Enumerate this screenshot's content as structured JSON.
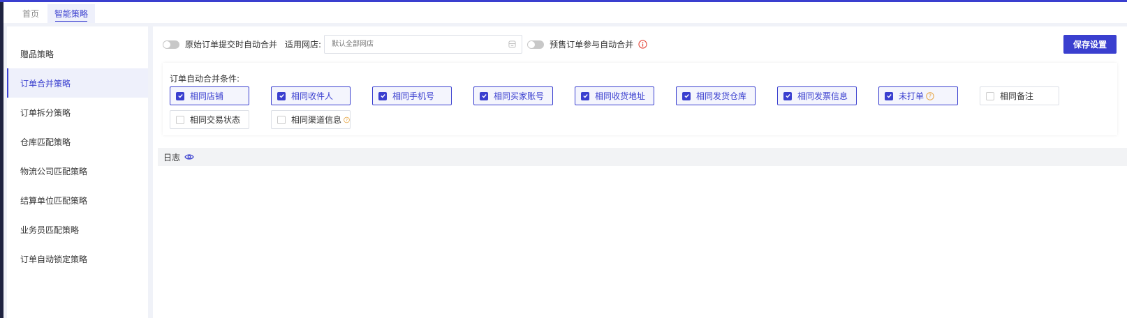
{
  "tabs": [
    {
      "label": "首页",
      "active": false
    },
    {
      "label": "智能策略",
      "active": true
    }
  ],
  "sidebar": {
    "items": [
      {
        "label": "赠品策略",
        "active": false
      },
      {
        "label": "订单合并策略",
        "active": true
      },
      {
        "label": "订单拆分策略",
        "active": false
      },
      {
        "label": "仓库匹配策略",
        "active": false
      },
      {
        "label": "物流公司匹配策略",
        "active": false
      },
      {
        "label": "结算单位匹配策略",
        "active": false
      },
      {
        "label": "业务员匹配策略",
        "active": false
      },
      {
        "label": "订单自动锁定策略",
        "active": false
      }
    ]
  },
  "toolbar": {
    "auto_merge_label": "原始订单提交时自动合并",
    "auto_merge_on": false,
    "shop_label": "适用网店:",
    "shop_placeholder": "默认全部网店",
    "presale_label": "预售订单参与自动合并",
    "presale_on": false,
    "save_label": "保存设置"
  },
  "conditions": {
    "title": "订单自动合并条件:",
    "items": [
      {
        "label": "相同店铺",
        "checked": true,
        "help": false
      },
      {
        "label": "相同收件人",
        "checked": true,
        "help": false
      },
      {
        "label": "相同手机号",
        "checked": true,
        "help": false
      },
      {
        "label": "相同买家账号",
        "checked": true,
        "help": false
      },
      {
        "label": "相同收货地址",
        "checked": true,
        "help": false
      },
      {
        "label": "相同发货仓库",
        "checked": true,
        "help": false
      },
      {
        "label": "相同发票信息",
        "checked": true,
        "help": false
      },
      {
        "label": "未打单",
        "checked": true,
        "help": true
      },
      {
        "label": "相同备注",
        "checked": false,
        "help": false
      },
      {
        "label": "相同交易状态",
        "checked": false,
        "help": false
      },
      {
        "label": "相同渠道信息",
        "checked": false,
        "help": true
      }
    ]
  },
  "log": {
    "label": "日志"
  },
  "colors": {
    "accent": "#3a3fcf",
    "warn": "#e6a23c",
    "danger": "#e54d42"
  }
}
